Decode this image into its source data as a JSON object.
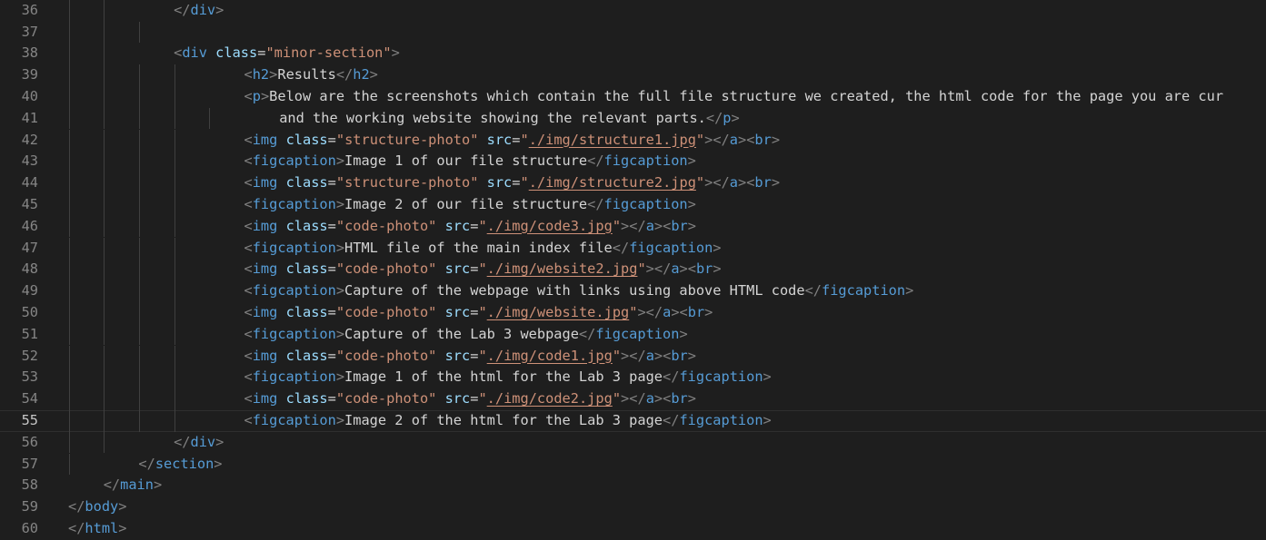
{
  "editor": {
    "colors": {
      "background": "#1e1e1e",
      "line_number": "#858585",
      "punctuation": "#808080",
      "tag": "#569cd6",
      "attribute": "#9cdcfe",
      "string": "#ce9178",
      "text": "#d4d4d4"
    },
    "current_line": 55,
    "lines": [
      {
        "num": 36,
        "indent": 3,
        "guides": [
          1,
          2
        ],
        "tokens": [
          {
            "k": "p",
            "v": "</"
          },
          {
            "k": "tag",
            "v": "div"
          },
          {
            "k": "p",
            "v": ">"
          }
        ]
      },
      {
        "num": 37,
        "indent": 0,
        "guides": [
          1,
          2,
          3
        ],
        "tokens": []
      },
      {
        "num": 38,
        "indent": 3,
        "guides": [
          1,
          2
        ],
        "tokens": [
          {
            "k": "p",
            "v": "<"
          },
          {
            "k": "tag",
            "v": "div"
          },
          {
            "k": "t",
            "v": " "
          },
          {
            "k": "attr",
            "v": "class"
          },
          {
            "k": "t",
            "v": "="
          },
          {
            "k": "str",
            "v": "\"minor-section\""
          },
          {
            "k": "p",
            "v": ">"
          }
        ]
      },
      {
        "num": 39,
        "indent": 5,
        "guides": [
          1,
          2,
          3,
          4
        ],
        "tokens": [
          {
            "k": "p",
            "v": "<"
          },
          {
            "k": "tag",
            "v": "h2"
          },
          {
            "k": "p",
            "v": ">"
          },
          {
            "k": "t",
            "v": "Results"
          },
          {
            "k": "p",
            "v": "</"
          },
          {
            "k": "tag",
            "v": "h2"
          },
          {
            "k": "p",
            "v": ">"
          }
        ]
      },
      {
        "num": 40,
        "indent": 5,
        "guides": [
          1,
          2,
          3,
          4
        ],
        "tokens": [
          {
            "k": "p",
            "v": "<"
          },
          {
            "k": "tag",
            "v": "p"
          },
          {
            "k": "p",
            "v": ">"
          },
          {
            "k": "t",
            "v": "Below are the screenshots which contain the full file structure we created, the html code for the page you are cur"
          }
        ]
      },
      {
        "num": 41,
        "indent": 6,
        "guides": [
          1,
          2,
          3,
          4,
          5
        ],
        "tokens": [
          {
            "k": "t",
            "v": "and the working website showing the relevant parts."
          },
          {
            "k": "p",
            "v": "</"
          },
          {
            "k": "tag",
            "v": "p"
          },
          {
            "k": "p",
            "v": ">"
          }
        ]
      },
      {
        "num": 42,
        "indent": 5,
        "guides": [
          1,
          2,
          3,
          4
        ],
        "tokens": [
          {
            "k": "p",
            "v": "<"
          },
          {
            "k": "tag",
            "v": "img"
          },
          {
            "k": "t",
            "v": " "
          },
          {
            "k": "attr",
            "v": "class"
          },
          {
            "k": "t",
            "v": "="
          },
          {
            "k": "str",
            "v": "\"structure-photo\""
          },
          {
            "k": "t",
            "v": " "
          },
          {
            "k": "attr",
            "v": "src"
          },
          {
            "k": "t",
            "v": "="
          },
          {
            "k": "str",
            "v": "\""
          },
          {
            "k": "link",
            "v": "./img/structure1.jpg"
          },
          {
            "k": "str",
            "v": "\""
          },
          {
            "k": "p",
            "v": "></"
          },
          {
            "k": "tag",
            "v": "a"
          },
          {
            "k": "p",
            "v": "><"
          },
          {
            "k": "tag",
            "v": "br"
          },
          {
            "k": "p",
            "v": ">"
          }
        ]
      },
      {
        "num": 43,
        "indent": 5,
        "guides": [
          1,
          2,
          3,
          4
        ],
        "tokens": [
          {
            "k": "p",
            "v": "<"
          },
          {
            "k": "tag",
            "v": "figcaption"
          },
          {
            "k": "p",
            "v": ">"
          },
          {
            "k": "t",
            "v": "Image 1 of our file structure"
          },
          {
            "k": "p",
            "v": "</"
          },
          {
            "k": "tag",
            "v": "figcaption"
          },
          {
            "k": "p",
            "v": ">"
          }
        ]
      },
      {
        "num": 44,
        "indent": 5,
        "guides": [
          1,
          2,
          3,
          4
        ],
        "tokens": [
          {
            "k": "p",
            "v": "<"
          },
          {
            "k": "tag",
            "v": "img"
          },
          {
            "k": "t",
            "v": " "
          },
          {
            "k": "attr",
            "v": "class"
          },
          {
            "k": "t",
            "v": "="
          },
          {
            "k": "str",
            "v": "\"structure-photo\""
          },
          {
            "k": "t",
            "v": " "
          },
          {
            "k": "attr",
            "v": "src"
          },
          {
            "k": "t",
            "v": "="
          },
          {
            "k": "str",
            "v": "\""
          },
          {
            "k": "link",
            "v": "./img/structure2.jpg"
          },
          {
            "k": "str",
            "v": "\""
          },
          {
            "k": "p",
            "v": "></"
          },
          {
            "k": "tag",
            "v": "a"
          },
          {
            "k": "p",
            "v": "><"
          },
          {
            "k": "tag",
            "v": "br"
          },
          {
            "k": "p",
            "v": ">"
          }
        ]
      },
      {
        "num": 45,
        "indent": 5,
        "guides": [
          1,
          2,
          3,
          4
        ],
        "tokens": [
          {
            "k": "p",
            "v": "<"
          },
          {
            "k": "tag",
            "v": "figcaption"
          },
          {
            "k": "p",
            "v": ">"
          },
          {
            "k": "t",
            "v": "Image 2 of our file structure"
          },
          {
            "k": "p",
            "v": "</"
          },
          {
            "k": "tag",
            "v": "figcaption"
          },
          {
            "k": "p",
            "v": ">"
          }
        ]
      },
      {
        "num": 46,
        "indent": 5,
        "guides": [
          1,
          2,
          3,
          4
        ],
        "tokens": [
          {
            "k": "p",
            "v": "<"
          },
          {
            "k": "tag",
            "v": "img"
          },
          {
            "k": "t",
            "v": " "
          },
          {
            "k": "attr",
            "v": "class"
          },
          {
            "k": "t",
            "v": "="
          },
          {
            "k": "str",
            "v": "\"code-photo\""
          },
          {
            "k": "t",
            "v": " "
          },
          {
            "k": "attr",
            "v": "src"
          },
          {
            "k": "t",
            "v": "="
          },
          {
            "k": "str",
            "v": "\""
          },
          {
            "k": "link",
            "v": "./img/code3.jpg"
          },
          {
            "k": "str",
            "v": "\""
          },
          {
            "k": "p",
            "v": "></"
          },
          {
            "k": "tag",
            "v": "a"
          },
          {
            "k": "p",
            "v": "><"
          },
          {
            "k": "tag",
            "v": "br"
          },
          {
            "k": "p",
            "v": ">"
          }
        ]
      },
      {
        "num": 47,
        "indent": 5,
        "guides": [
          1,
          2,
          3,
          4
        ],
        "tokens": [
          {
            "k": "p",
            "v": "<"
          },
          {
            "k": "tag",
            "v": "figcaption"
          },
          {
            "k": "p",
            "v": ">"
          },
          {
            "k": "t",
            "v": "HTML file of the main index file"
          },
          {
            "k": "p",
            "v": "</"
          },
          {
            "k": "tag",
            "v": "figcaption"
          },
          {
            "k": "p",
            "v": ">"
          }
        ]
      },
      {
        "num": 48,
        "indent": 5,
        "guides": [
          1,
          2,
          3,
          4
        ],
        "tokens": [
          {
            "k": "p",
            "v": "<"
          },
          {
            "k": "tag",
            "v": "img"
          },
          {
            "k": "t",
            "v": " "
          },
          {
            "k": "attr",
            "v": "class"
          },
          {
            "k": "t",
            "v": "="
          },
          {
            "k": "str",
            "v": "\"code-photo\""
          },
          {
            "k": "t",
            "v": " "
          },
          {
            "k": "attr",
            "v": "src"
          },
          {
            "k": "t",
            "v": "="
          },
          {
            "k": "str",
            "v": "\""
          },
          {
            "k": "link",
            "v": "./img/website2.jpg"
          },
          {
            "k": "str",
            "v": "\""
          },
          {
            "k": "p",
            "v": "></"
          },
          {
            "k": "tag",
            "v": "a"
          },
          {
            "k": "p",
            "v": "><"
          },
          {
            "k": "tag",
            "v": "br"
          },
          {
            "k": "p",
            "v": ">"
          }
        ]
      },
      {
        "num": 49,
        "indent": 5,
        "guides": [
          1,
          2,
          3,
          4
        ],
        "tokens": [
          {
            "k": "p",
            "v": "<"
          },
          {
            "k": "tag",
            "v": "figcaption"
          },
          {
            "k": "p",
            "v": ">"
          },
          {
            "k": "t",
            "v": "Capture of the webpage with links using above HTML code"
          },
          {
            "k": "p",
            "v": "</"
          },
          {
            "k": "tag",
            "v": "figcaption"
          },
          {
            "k": "p",
            "v": ">"
          }
        ]
      },
      {
        "num": 50,
        "indent": 5,
        "guides": [
          1,
          2,
          3,
          4
        ],
        "tokens": [
          {
            "k": "p",
            "v": "<"
          },
          {
            "k": "tag",
            "v": "img"
          },
          {
            "k": "t",
            "v": " "
          },
          {
            "k": "attr",
            "v": "class"
          },
          {
            "k": "t",
            "v": "="
          },
          {
            "k": "str",
            "v": "\"code-photo\""
          },
          {
            "k": "t",
            "v": " "
          },
          {
            "k": "attr",
            "v": "src"
          },
          {
            "k": "t",
            "v": "="
          },
          {
            "k": "str",
            "v": "\""
          },
          {
            "k": "link",
            "v": "./img/website.jpg"
          },
          {
            "k": "str",
            "v": "\""
          },
          {
            "k": "p",
            "v": "></"
          },
          {
            "k": "tag",
            "v": "a"
          },
          {
            "k": "p",
            "v": "><"
          },
          {
            "k": "tag",
            "v": "br"
          },
          {
            "k": "p",
            "v": ">"
          }
        ]
      },
      {
        "num": 51,
        "indent": 5,
        "guides": [
          1,
          2,
          3,
          4
        ],
        "tokens": [
          {
            "k": "p",
            "v": "<"
          },
          {
            "k": "tag",
            "v": "figcaption"
          },
          {
            "k": "p",
            "v": ">"
          },
          {
            "k": "t",
            "v": "Capture of the Lab 3 webpage"
          },
          {
            "k": "p",
            "v": "</"
          },
          {
            "k": "tag",
            "v": "figcaption"
          },
          {
            "k": "p",
            "v": ">"
          }
        ]
      },
      {
        "num": 52,
        "indent": 5,
        "guides": [
          1,
          2,
          3,
          4
        ],
        "tokens": [
          {
            "k": "p",
            "v": "<"
          },
          {
            "k": "tag",
            "v": "img"
          },
          {
            "k": "t",
            "v": " "
          },
          {
            "k": "attr",
            "v": "class"
          },
          {
            "k": "t",
            "v": "="
          },
          {
            "k": "str",
            "v": "\"code-photo\""
          },
          {
            "k": "t",
            "v": " "
          },
          {
            "k": "attr",
            "v": "src"
          },
          {
            "k": "t",
            "v": "="
          },
          {
            "k": "str",
            "v": "\""
          },
          {
            "k": "link",
            "v": "./img/code1.jpg"
          },
          {
            "k": "str",
            "v": "\""
          },
          {
            "k": "p",
            "v": "></"
          },
          {
            "k": "tag",
            "v": "a"
          },
          {
            "k": "p",
            "v": "><"
          },
          {
            "k": "tag",
            "v": "br"
          },
          {
            "k": "p",
            "v": ">"
          }
        ]
      },
      {
        "num": 53,
        "indent": 5,
        "guides": [
          1,
          2,
          3,
          4
        ],
        "tokens": [
          {
            "k": "p",
            "v": "<"
          },
          {
            "k": "tag",
            "v": "figcaption"
          },
          {
            "k": "p",
            "v": ">"
          },
          {
            "k": "t",
            "v": "Image 1 of the html for the Lab 3 page"
          },
          {
            "k": "p",
            "v": "</"
          },
          {
            "k": "tag",
            "v": "figcaption"
          },
          {
            "k": "p",
            "v": ">"
          }
        ]
      },
      {
        "num": 54,
        "indent": 5,
        "guides": [
          1,
          2,
          3,
          4
        ],
        "tokens": [
          {
            "k": "p",
            "v": "<"
          },
          {
            "k": "tag",
            "v": "img"
          },
          {
            "k": "t",
            "v": " "
          },
          {
            "k": "attr",
            "v": "class"
          },
          {
            "k": "t",
            "v": "="
          },
          {
            "k": "str",
            "v": "\"code-photo\""
          },
          {
            "k": "t",
            "v": " "
          },
          {
            "k": "attr",
            "v": "src"
          },
          {
            "k": "t",
            "v": "="
          },
          {
            "k": "str",
            "v": "\""
          },
          {
            "k": "link",
            "v": "./img/code2.jpg"
          },
          {
            "k": "str",
            "v": "\""
          },
          {
            "k": "p",
            "v": "></"
          },
          {
            "k": "tag",
            "v": "a"
          },
          {
            "k": "p",
            "v": "><"
          },
          {
            "k": "tag",
            "v": "br"
          },
          {
            "k": "p",
            "v": ">"
          }
        ]
      },
      {
        "num": 55,
        "indent": 5,
        "guides": [
          1,
          2,
          3,
          4
        ],
        "tokens": [
          {
            "k": "p",
            "v": "<"
          },
          {
            "k": "tag",
            "v": "figcaption"
          },
          {
            "k": "p",
            "v": ">"
          },
          {
            "k": "t",
            "v": "Image 2 of the html for the Lab 3 page"
          },
          {
            "k": "p",
            "v": "</"
          },
          {
            "k": "tag",
            "v": "figcaption"
          },
          {
            "k": "p",
            "v": ">"
          }
        ]
      },
      {
        "num": 56,
        "indent": 3,
        "guides": [
          1,
          2
        ],
        "tokens": [
          {
            "k": "p",
            "v": "</"
          },
          {
            "k": "tag",
            "v": "div"
          },
          {
            "k": "p",
            "v": ">"
          }
        ]
      },
      {
        "num": 57,
        "indent": 2,
        "guides": [
          1
        ],
        "tokens": [
          {
            "k": "p",
            "v": "</"
          },
          {
            "k": "tag",
            "v": "section"
          },
          {
            "k": "p",
            "v": ">"
          }
        ]
      },
      {
        "num": 58,
        "indent": 1,
        "guides": [],
        "tokens": [
          {
            "k": "p",
            "v": "</"
          },
          {
            "k": "tag",
            "v": "main"
          },
          {
            "k": "p",
            "v": ">"
          }
        ]
      },
      {
        "num": 59,
        "indent": 0,
        "guides": [],
        "tokens": [
          {
            "k": "p",
            "v": "</"
          },
          {
            "k": "tag",
            "v": "body"
          },
          {
            "k": "p",
            "v": ">"
          }
        ]
      },
      {
        "num": 60,
        "indent": 0,
        "guides": [],
        "tokens": [
          {
            "k": "p",
            "v": "</"
          },
          {
            "k": "tag",
            "v": "html"
          },
          {
            "k": "p",
            "v": ">"
          }
        ]
      }
    ]
  }
}
